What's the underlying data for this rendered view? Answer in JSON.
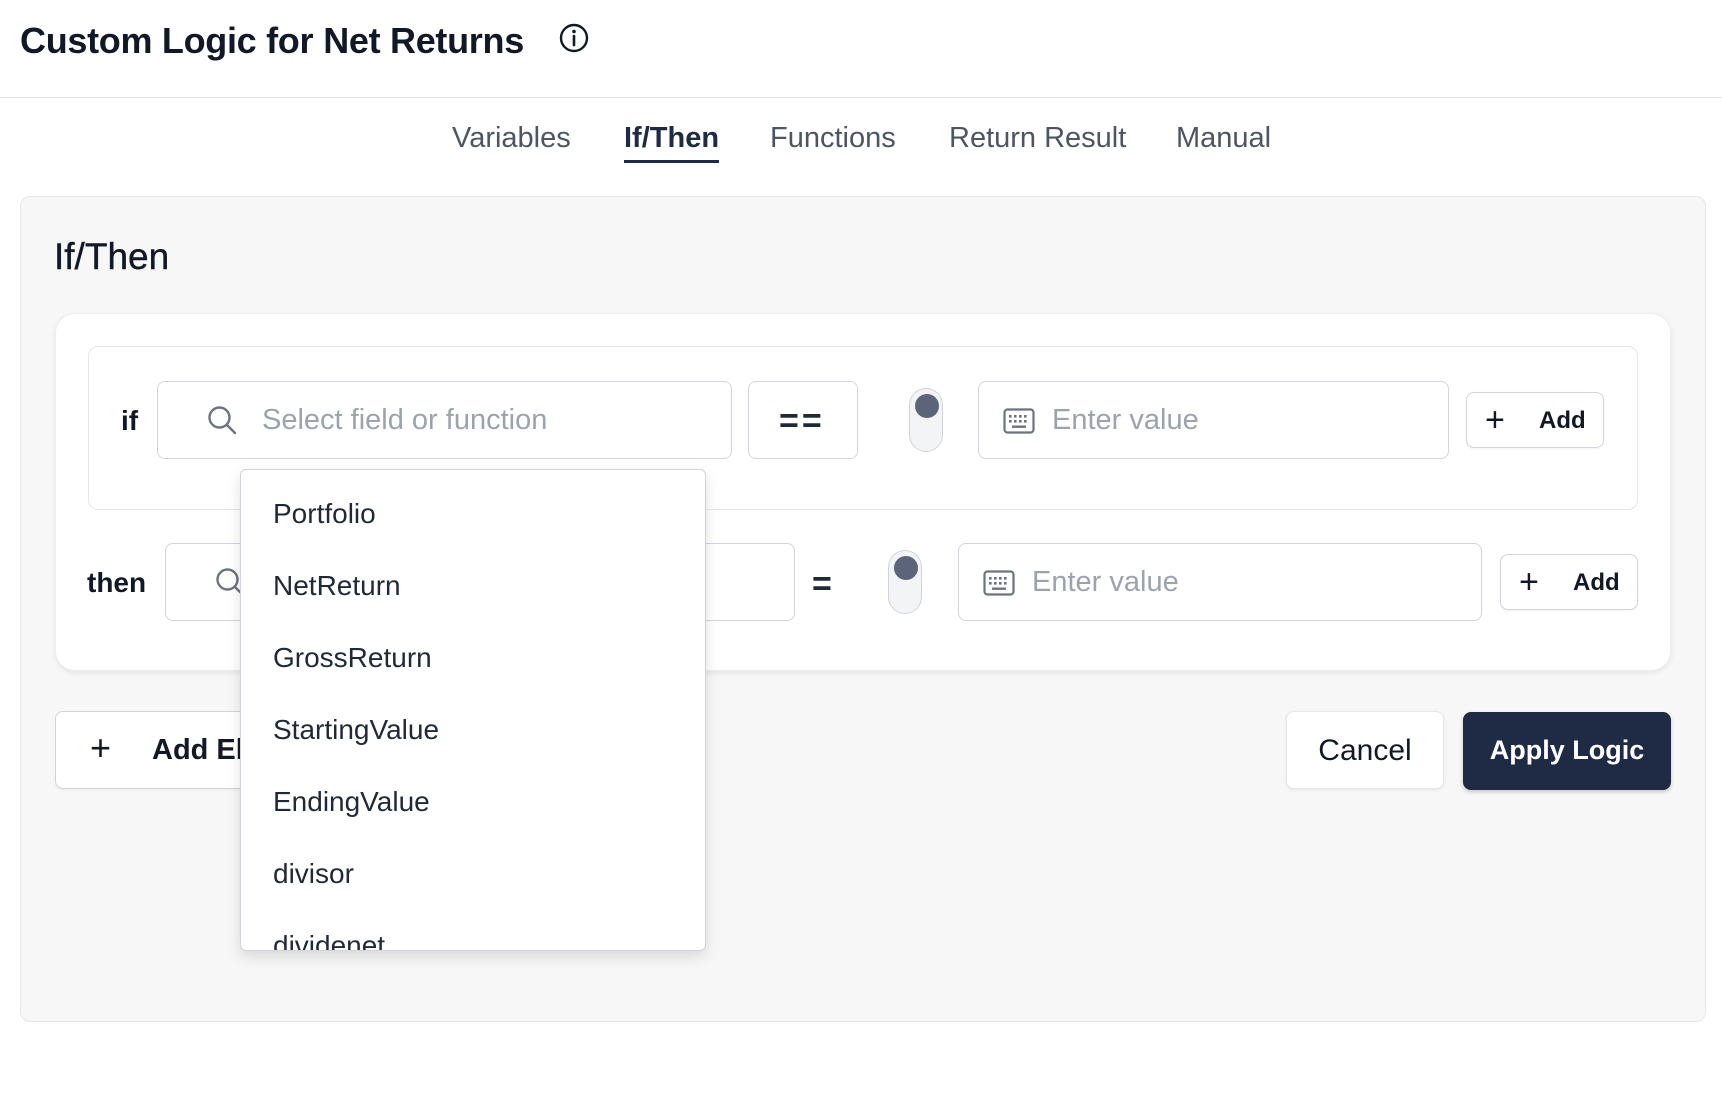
{
  "header": {
    "title_prefix": "Custom Logic for",
    "title_subject": "Net Returns",
    "info_icon": "info-circle-icon"
  },
  "tabs": [
    {
      "label": "Variables"
    },
    {
      "label": "If/Then",
      "active": true
    },
    {
      "label": "Functions"
    },
    {
      "label": "Return Result"
    },
    {
      "label": "Manual"
    }
  ],
  "panel": {
    "heading": "If/Then"
  },
  "if_row": {
    "keyword": "if",
    "field_placeholder": "Select field or function",
    "operator": "==",
    "value_placeholder": "Enter value",
    "add_label": "Add"
  },
  "then_row": {
    "keyword": "then",
    "operator": "=",
    "value_placeholder": "Enter value",
    "add_label": "Add"
  },
  "dropdown": {
    "options": [
      "Portfolio",
      "NetReturn",
      "GrossReturn",
      "StartingValue",
      "EndingValue",
      "divisor",
      "dividenet"
    ]
  },
  "footer": {
    "add_else_label": "Add Else",
    "cancel_label": "Cancel",
    "apply_label": "Apply Logic"
  },
  "colors": {
    "primary": "#1f2a44",
    "panel_bg": "#f7f7f7",
    "border": "#d1d5db",
    "placeholder": "#9ca3af"
  }
}
